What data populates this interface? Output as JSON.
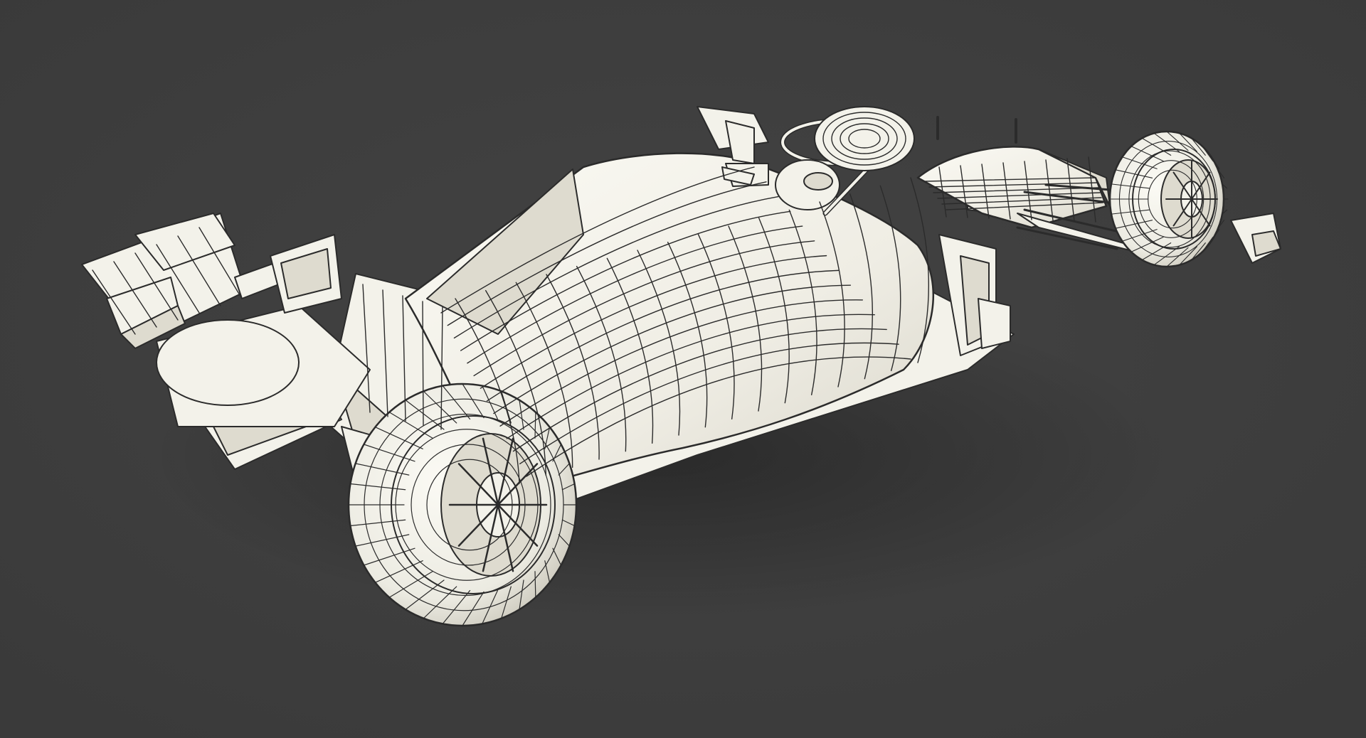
{
  "scene": {
    "subject": "formula-one-car-wireframe-render",
    "colors": {
      "background": "#434343",
      "background_edge": "#3a3a3a",
      "surface": "#f3f2ea",
      "surface_shade": "#dedbcf",
      "surface_deep": "#c9c6ba",
      "wire": "#2b2b2b",
      "shadow": "#2e2e2e"
    }
  }
}
